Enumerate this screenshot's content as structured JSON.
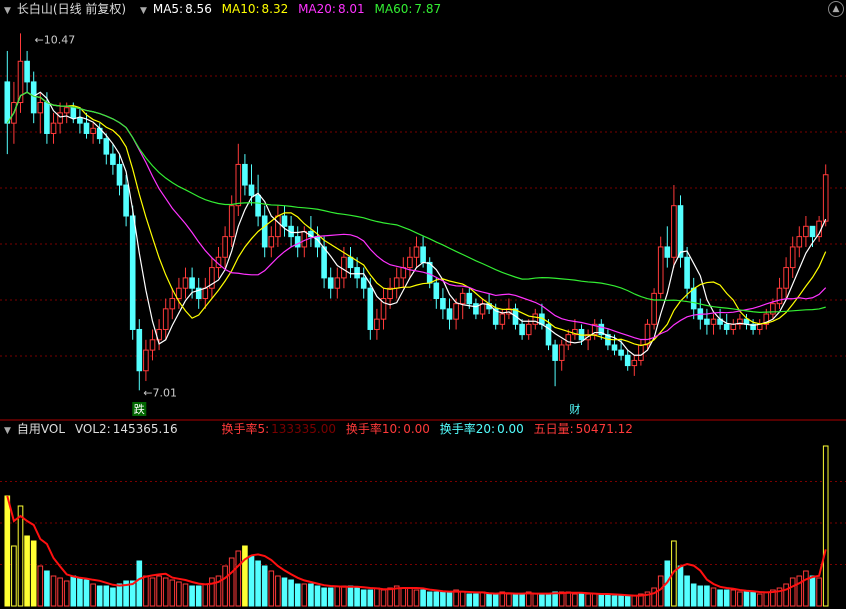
{
  "colors": {
    "up": "#ff3a3a",
    "down": "#54ffff",
    "ma5": "#ffffff",
    "ma10": "#ffff00",
    "ma20": "#ff33ff",
    "ma60": "#33ee33",
    "gridline": "#7a0000",
    "axis": "#aa0000",
    "vol_flat": "#33ee33",
    "vol_up": "#ff3a3a",
    "vol_down": "#54ffff",
    "vol_dark": "#0033ff",
    "vol_hi": "#ffff33",
    "vol_ma": "#ff1010"
  },
  "price_legend": {
    "title": "长白山(日线 前复权)",
    "ma5_label": "MA5:",
    "ma5": "8.56",
    "ma10_label": "MA10:",
    "ma10": "8.32",
    "ma20_label": "MA20:",
    "ma20": "8.01",
    "ma60_label": "MA60:",
    "ma60": "7.87"
  },
  "volume_legend": {
    "title": "自用VOL",
    "vol2_label": "VOL2:",
    "vol2": "145365.16",
    "hsl5_label": "换手率5:",
    "hsl5": "133335.00",
    "hsl10_label": "换手率10:",
    "hsl10": "0.00",
    "hsl20_label": "换手率20:",
    "hsl20": "0.00",
    "wuri_label": "五日量:",
    "wuri": "50471.12"
  },
  "chart_data": {
    "type": "candlestick",
    "price_range": [
      6.8,
      10.6
    ],
    "max_label": "10.47",
    "min_label": "7.01",
    "markers": [
      {
        "index": 20,
        "text": "跌"
      },
      {
        "index": 86,
        "text": "财"
      }
    ],
    "ohlc": [
      [
        10.0,
        10.3,
        9.3,
        9.6
      ],
      [
        9.6,
        10.0,
        9.4,
        9.8
      ],
      [
        9.8,
        10.47,
        9.7,
        10.2
      ],
      [
        10.2,
        10.3,
        9.9,
        10.0
      ],
      [
        10.0,
        10.1,
        9.6,
        9.7
      ],
      [
        9.7,
        9.9,
        9.5,
        9.8
      ],
      [
        9.8,
        9.9,
        9.4,
        9.5
      ],
      [
        9.5,
        9.7,
        9.4,
        9.6
      ],
      [
        9.6,
        9.8,
        9.5,
        9.7
      ],
      [
        9.7,
        9.8,
        9.6,
        9.75
      ],
      [
        9.75,
        9.8,
        9.6,
        9.65
      ],
      [
        9.65,
        9.75,
        9.5,
        9.6
      ],
      [
        9.6,
        9.7,
        9.45,
        9.5
      ],
      [
        9.5,
        9.6,
        9.4,
        9.55
      ],
      [
        9.55,
        9.6,
        9.4,
        9.45
      ],
      [
        9.45,
        9.5,
        9.2,
        9.3
      ],
      [
        9.3,
        9.4,
        9.1,
        9.2
      ],
      [
        9.2,
        9.3,
        8.9,
        9.0
      ],
      [
        9.0,
        9.1,
        8.6,
        8.7
      ],
      [
        8.7,
        8.8,
        7.5,
        7.6
      ],
      [
        7.6,
        7.7,
        7.01,
        7.2
      ],
      [
        7.2,
        7.5,
        7.1,
        7.4
      ],
      [
        7.4,
        7.6,
        7.3,
        7.5
      ],
      [
        7.5,
        7.7,
        7.4,
        7.6
      ],
      [
        7.6,
        7.9,
        7.5,
        7.8
      ],
      [
        7.8,
        8.0,
        7.7,
        7.9
      ],
      [
        7.9,
        8.1,
        7.8,
        8.0
      ],
      [
        8.0,
        8.2,
        7.9,
        8.1
      ],
      [
        8.1,
        8.2,
        7.9,
        8.0
      ],
      [
        8.0,
        8.1,
        7.8,
        7.9
      ],
      [
        7.9,
        8.1,
        7.8,
        8.0
      ],
      [
        8.0,
        8.3,
        7.9,
        8.2
      ],
      [
        8.2,
        8.4,
        8.1,
        8.3
      ],
      [
        8.3,
        8.6,
        8.2,
        8.5
      ],
      [
        8.5,
        8.9,
        8.4,
        8.8
      ],
      [
        8.8,
        9.4,
        8.7,
        9.2
      ],
      [
        9.2,
        9.3,
        8.9,
        9.0
      ],
      [
        9.0,
        9.2,
        8.8,
        8.9
      ],
      [
        8.9,
        9.1,
        8.6,
        8.7
      ],
      [
        8.7,
        8.8,
        8.3,
        8.4
      ],
      [
        8.4,
        8.6,
        8.3,
        8.5
      ],
      [
        8.5,
        8.8,
        8.4,
        8.7
      ],
      [
        8.7,
        8.8,
        8.5,
        8.6
      ],
      [
        8.6,
        8.7,
        8.4,
        8.5
      ],
      [
        8.5,
        8.6,
        8.3,
        8.4
      ],
      [
        8.4,
        8.6,
        8.3,
        8.55
      ],
      [
        8.55,
        8.7,
        8.4,
        8.5
      ],
      [
        8.5,
        8.6,
        8.3,
        8.4
      ],
      [
        8.4,
        8.5,
        8.0,
        8.1
      ],
      [
        8.1,
        8.2,
        7.9,
        8.0
      ],
      [
        8.0,
        8.2,
        7.9,
        8.1
      ],
      [
        8.1,
        8.4,
        8.0,
        8.3
      ],
      [
        8.3,
        8.4,
        8.1,
        8.2
      ],
      [
        8.2,
        8.3,
        8.0,
        8.1
      ],
      [
        8.1,
        8.2,
        7.9,
        8.0
      ],
      [
        8.0,
        8.1,
        7.5,
        7.6
      ],
      [
        7.6,
        7.8,
        7.5,
        7.7
      ],
      [
        7.7,
        8.0,
        7.6,
        7.9
      ],
      [
        7.9,
        8.1,
        7.8,
        8.0
      ],
      [
        8.0,
        8.2,
        7.9,
        8.1
      ],
      [
        8.1,
        8.3,
        8.0,
        8.2
      ],
      [
        8.2,
        8.4,
        8.1,
        8.3
      ],
      [
        8.3,
        8.5,
        8.2,
        8.4
      ],
      [
        8.4,
        8.5,
        8.2,
        8.25
      ],
      [
        8.25,
        8.3,
        8.0,
        8.05
      ],
      [
        8.05,
        8.1,
        7.8,
        7.9
      ],
      [
        7.9,
        8.0,
        7.7,
        7.8
      ],
      [
        7.8,
        7.9,
        7.6,
        7.7
      ],
      [
        7.7,
        7.9,
        7.6,
        7.85
      ],
      [
        7.85,
        8.0,
        7.7,
        7.95
      ],
      [
        7.95,
        8.0,
        7.8,
        7.85
      ],
      [
        7.85,
        7.9,
        7.7,
        7.75
      ],
      [
        7.75,
        7.9,
        7.7,
        7.85
      ],
      [
        7.85,
        7.95,
        7.75,
        7.8
      ],
      [
        7.8,
        7.85,
        7.6,
        7.65
      ],
      [
        7.65,
        7.8,
        7.6,
        7.75
      ],
      [
        7.75,
        7.9,
        7.7,
        7.8
      ],
      [
        7.8,
        7.85,
        7.6,
        7.65
      ],
      [
        7.65,
        7.7,
        7.5,
        7.55
      ],
      [
        7.55,
        7.7,
        7.5,
        7.65
      ],
      [
        7.65,
        7.8,
        7.6,
        7.75
      ],
      [
        7.75,
        7.85,
        7.6,
        7.65
      ],
      [
        7.65,
        7.7,
        7.4,
        7.45
      ],
      [
        7.45,
        7.5,
        7.05,
        7.3
      ],
      [
        7.3,
        7.5,
        7.2,
        7.45
      ],
      [
        7.45,
        7.6,
        7.4,
        7.55
      ],
      [
        7.55,
        7.7,
        7.5,
        7.6
      ],
      [
        7.6,
        7.65,
        7.45,
        7.5
      ],
      [
        7.5,
        7.6,
        7.4,
        7.55
      ],
      [
        7.55,
        7.7,
        7.5,
        7.65
      ],
      [
        7.65,
        7.7,
        7.5,
        7.55
      ],
      [
        7.55,
        7.6,
        7.4,
        7.45
      ],
      [
        7.45,
        7.55,
        7.35,
        7.4
      ],
      [
        7.4,
        7.5,
        7.3,
        7.35
      ],
      [
        7.35,
        7.4,
        7.2,
        7.25
      ],
      [
        7.25,
        7.35,
        7.15,
        7.3
      ],
      [
        7.3,
        7.5,
        7.25,
        7.45
      ],
      [
        7.45,
        7.7,
        7.4,
        7.65
      ],
      [
        7.65,
        8.0,
        7.6,
        7.95
      ],
      [
        7.95,
        8.5,
        7.9,
        8.4
      ],
      [
        8.4,
        8.6,
        8.2,
        8.3
      ],
      [
        8.3,
        9.0,
        8.2,
        8.8
      ],
      [
        8.8,
        8.9,
        8.2,
        8.3
      ],
      [
        8.3,
        8.4,
        7.9,
        8.0
      ],
      [
        8.0,
        8.1,
        7.7,
        7.8
      ],
      [
        7.8,
        7.9,
        7.6,
        7.7
      ],
      [
        7.7,
        7.8,
        7.55,
        7.65
      ],
      [
        7.65,
        7.75,
        7.55,
        7.7
      ],
      [
        7.7,
        7.8,
        7.6,
        7.65
      ],
      [
        7.65,
        7.75,
        7.55,
        7.6
      ],
      [
        7.6,
        7.7,
        7.55,
        7.65
      ],
      [
        7.65,
        7.75,
        7.6,
        7.7
      ],
      [
        7.7,
        7.75,
        7.6,
        7.65
      ],
      [
        7.65,
        7.7,
        7.55,
        7.6
      ],
      [
        7.6,
        7.7,
        7.55,
        7.65
      ],
      [
        7.65,
        7.8,
        7.6,
        7.75
      ],
      [
        7.75,
        7.9,
        7.7,
        7.85
      ],
      [
        7.85,
        8.1,
        7.8,
        8.0
      ],
      [
        8.0,
        8.3,
        7.9,
        8.2
      ],
      [
        8.2,
        8.5,
        8.1,
        8.4
      ],
      [
        8.4,
        8.6,
        8.3,
        8.5
      ],
      [
        8.5,
        8.7,
        8.4,
        8.6
      ],
      [
        8.6,
        8.6,
        8.4,
        8.5
      ],
      [
        8.5,
        8.7,
        8.45,
        8.65
      ],
      [
        8.65,
        9.2,
        8.6,
        9.1
      ]
    ],
    "volume": [
      110,
      60,
      100,
      70,
      65,
      40,
      35,
      30,
      28,
      25,
      30,
      28,
      26,
      22,
      20,
      20,
      18,
      22,
      25,
      25,
      45,
      30,
      28,
      30,
      28,
      26,
      24,
      22,
      20,
      20,
      22,
      28,
      30,
      40,
      48,
      55,
      60,
      50,
      45,
      40,
      35,
      30,
      28,
      26,
      22,
      22,
      22,
      20,
      18,
      18,
      20,
      20,
      20,
      18,
      16,
      16,
      18,
      16,
      18,
      20,
      18,
      18,
      16,
      16,
      14,
      14,
      14,
      14,
      16,
      14,
      12,
      12,
      14,
      12,
      12,
      14,
      12,
      12,
      12,
      14,
      12,
      12,
      12,
      14,
      14,
      14,
      12,
      12,
      12,
      12,
      12,
      12,
      10,
      10,
      10,
      10,
      12,
      14,
      18,
      30,
      45,
      65,
      40,
      30,
      22,
      20,
      20,
      18,
      16,
      16,
      16,
      14,
      14,
      14,
      12,
      14,
      16,
      18,
      22,
      28,
      30,
      35,
      30,
      28,
      160
    ],
    "volume_ma_last": 145365.16
  }
}
